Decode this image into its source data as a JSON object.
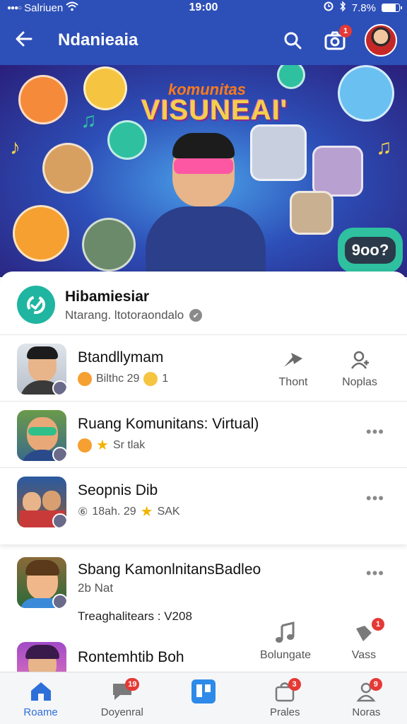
{
  "status_bar": {
    "carrier": "Salriuen",
    "time": "19:00",
    "battery": "7.8%",
    "battery_level": 0.78
  },
  "app_bar": {
    "title": "Ndanieaia",
    "camera_badge": "1"
  },
  "banner": {
    "headline_small": "komunitas",
    "headline_large": "VISUNEAI'",
    "chat_bubble": "9oo?"
  },
  "community": {
    "name": "Hibamiesiar",
    "subtitle": "Ntarang. ltotoraondalo"
  },
  "feed": [
    {
      "title": "Btandllymam",
      "meta": "Bilthc 29",
      "meta_extra": "1",
      "actions": [
        {
          "icon": "share-arrow-icon",
          "label": "Thont"
        },
        {
          "icon": "person-add-icon",
          "label": "Noplas"
        }
      ]
    },
    {
      "title": "Ruang Komunitans: Virtual)",
      "meta": "Sr tlak",
      "more": "•••"
    },
    {
      "title": "Seopnis Dib",
      "meta_prefix": "⑥",
      "meta": "18ah. 29",
      "meta_extra": "SAK",
      "more": "•••"
    }
  ],
  "post": {
    "title": "Sbang KamonlnitansBadleo",
    "meta": "2b Nat",
    "extra": "Treaghalitears : V208",
    "more": "•••"
  },
  "post2": {
    "title": "Rontemhtib Boh",
    "actions": [
      {
        "icon": "music-note-icon",
        "label": "Bolungate"
      },
      {
        "icon": "heart-icon",
        "label": "Vass",
        "badge": "1"
      }
    ]
  },
  "bottom_nav": [
    {
      "icon": "home-icon",
      "label": "Roame",
      "active": true
    },
    {
      "icon": "chat-icon",
      "label": "Doyenral",
      "badge": "19"
    },
    {
      "icon": "board-icon",
      "label": ""
    },
    {
      "icon": "bag-icon",
      "label": "Prales",
      "badge": "3"
    },
    {
      "icon": "people-icon",
      "label": "Noras",
      "badge": "9"
    }
  ]
}
